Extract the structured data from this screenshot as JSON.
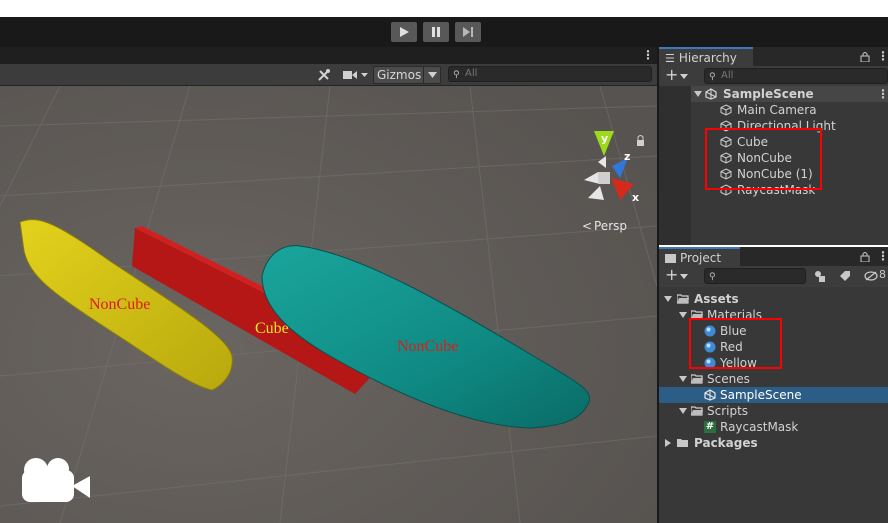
{
  "play_controls": {
    "play_icon": "play-icon",
    "pause_icon": "pause-icon",
    "step_icon": "step-icon"
  },
  "scene_view": {
    "gizmos_label": "Gizmos",
    "search_placeholder": "All",
    "persp_label": "Persp",
    "axis_labels": {
      "y": "y",
      "z": "z",
      "x": "x"
    },
    "objects": [
      {
        "label": "NonCube",
        "color": "#d4c411",
        "label_color": "#e01b1b"
      },
      {
        "label": "Cube",
        "color": "#b81515",
        "label_color": "#e8e630"
      },
      {
        "label": "NonCube",
        "color": "#118b84",
        "label_color": "#e01b1b"
      }
    ]
  },
  "hierarchy": {
    "tab_label": "Hierarchy",
    "search_placeholder": "All",
    "scene_name": "SampleScene",
    "items": [
      {
        "label": "Main Camera"
      },
      {
        "label": "Directional Light"
      },
      {
        "label": "Cube"
      },
      {
        "label": "NonCube"
      },
      {
        "label": "NonCube (1)"
      },
      {
        "label": "RaycastMask"
      }
    ]
  },
  "project": {
    "tab_label": "Project",
    "hidden_count": "8",
    "tree": {
      "assets": "Assets",
      "materials": "Materials",
      "material_items": [
        "Blue",
        "Red",
        "Yellow"
      ],
      "scenes": "Scenes",
      "scene_item": "SampleScene",
      "scripts": "Scripts",
      "script_item": "RaycastMask",
      "packages": "Packages"
    }
  },
  "colors": {
    "highlight": "#ff0000",
    "selection": "#2c5d87",
    "tab_accent": "#3a79bb"
  }
}
